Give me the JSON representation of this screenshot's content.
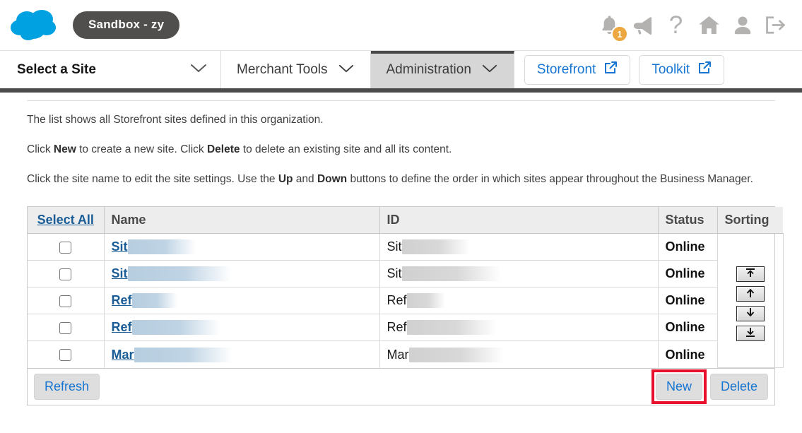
{
  "topbar": {
    "logo_icon": "salesforce-cloud-icon",
    "logo_color": "#00a1e0",
    "sandbox_label": "Sandbox - zy",
    "sandbox_bg": "#514f4d",
    "icons": [
      {
        "name": "notifications-bell-icon",
        "badge": "1",
        "badge_color": "#eda741"
      },
      {
        "name": "megaphone-icon"
      },
      {
        "name": "help-question-icon",
        "glyph": "?"
      },
      {
        "name": "home-icon"
      },
      {
        "name": "user-profile-icon"
      },
      {
        "name": "logout-icon"
      }
    ]
  },
  "nav": {
    "site_select_label": "Select a Site",
    "tabs": [
      {
        "label": "Merchant Tools",
        "active": false
      },
      {
        "label": "Administration",
        "active": true
      }
    ],
    "link_buttons": [
      {
        "label": "Storefront",
        "icon": "external-link-icon"
      },
      {
        "label": "Toolkit",
        "icon": "external-link-icon"
      }
    ],
    "accent_color": "#1675d0"
  },
  "intro": {
    "p1": "The list shows all Storefront sites defined in this organization.",
    "p2_a": "Click ",
    "p2_b": "New",
    "p2_c": " to create a new site. Click ",
    "p2_d": "Delete",
    "p2_e": " to delete an existing site and all its content.",
    "p3_a": "Click the site name to edit the site settings. Use the ",
    "p3_b": "Up",
    "p3_c": " and ",
    "p3_d": "Down",
    "p3_e": " buttons to define the order in which sites appear throughout the Business Manager."
  },
  "table": {
    "headers": {
      "select_all": "Select All",
      "name": "Name",
      "id": "ID",
      "status": "Status",
      "sorting": "Sorting"
    },
    "rows": [
      {
        "checked": false,
        "name": "Sit",
        "name_redacted_width": 96,
        "id": "Sit",
        "id_redacted_width": 96,
        "status": "Online"
      },
      {
        "checked": false,
        "name": "Sit",
        "name_redacted_width": 146,
        "id": "Sit",
        "id_redacted_width": 140,
        "status": "Online"
      },
      {
        "checked": false,
        "name": "Ref",
        "name_redacted_width": 64,
        "id": "Ref",
        "id_redacted_width": 54,
        "status": "Online"
      },
      {
        "checked": false,
        "name": "Ref",
        "name_redacted_width": 124,
        "id": "Ref",
        "id_redacted_width": 126,
        "status": "Online"
      },
      {
        "checked": false,
        "name": "Mar",
        "name_redacted_width": 138,
        "id": "Mar",
        "id_redacted_width": 134,
        "status": "Online"
      }
    ],
    "sort_buttons": [
      {
        "name": "move-to-top-button",
        "icon": "arrow-to-top-icon"
      },
      {
        "name": "move-up-button",
        "icon": "arrow-up-icon"
      },
      {
        "name": "move-down-button",
        "icon": "arrow-down-icon"
      },
      {
        "name": "move-to-bottom-button",
        "icon": "arrow-to-bottom-icon"
      }
    ]
  },
  "footer": {
    "refresh_label": "Refresh",
    "new_label": "New",
    "delete_label": "Delete",
    "highlight_color": "#e8112d"
  }
}
